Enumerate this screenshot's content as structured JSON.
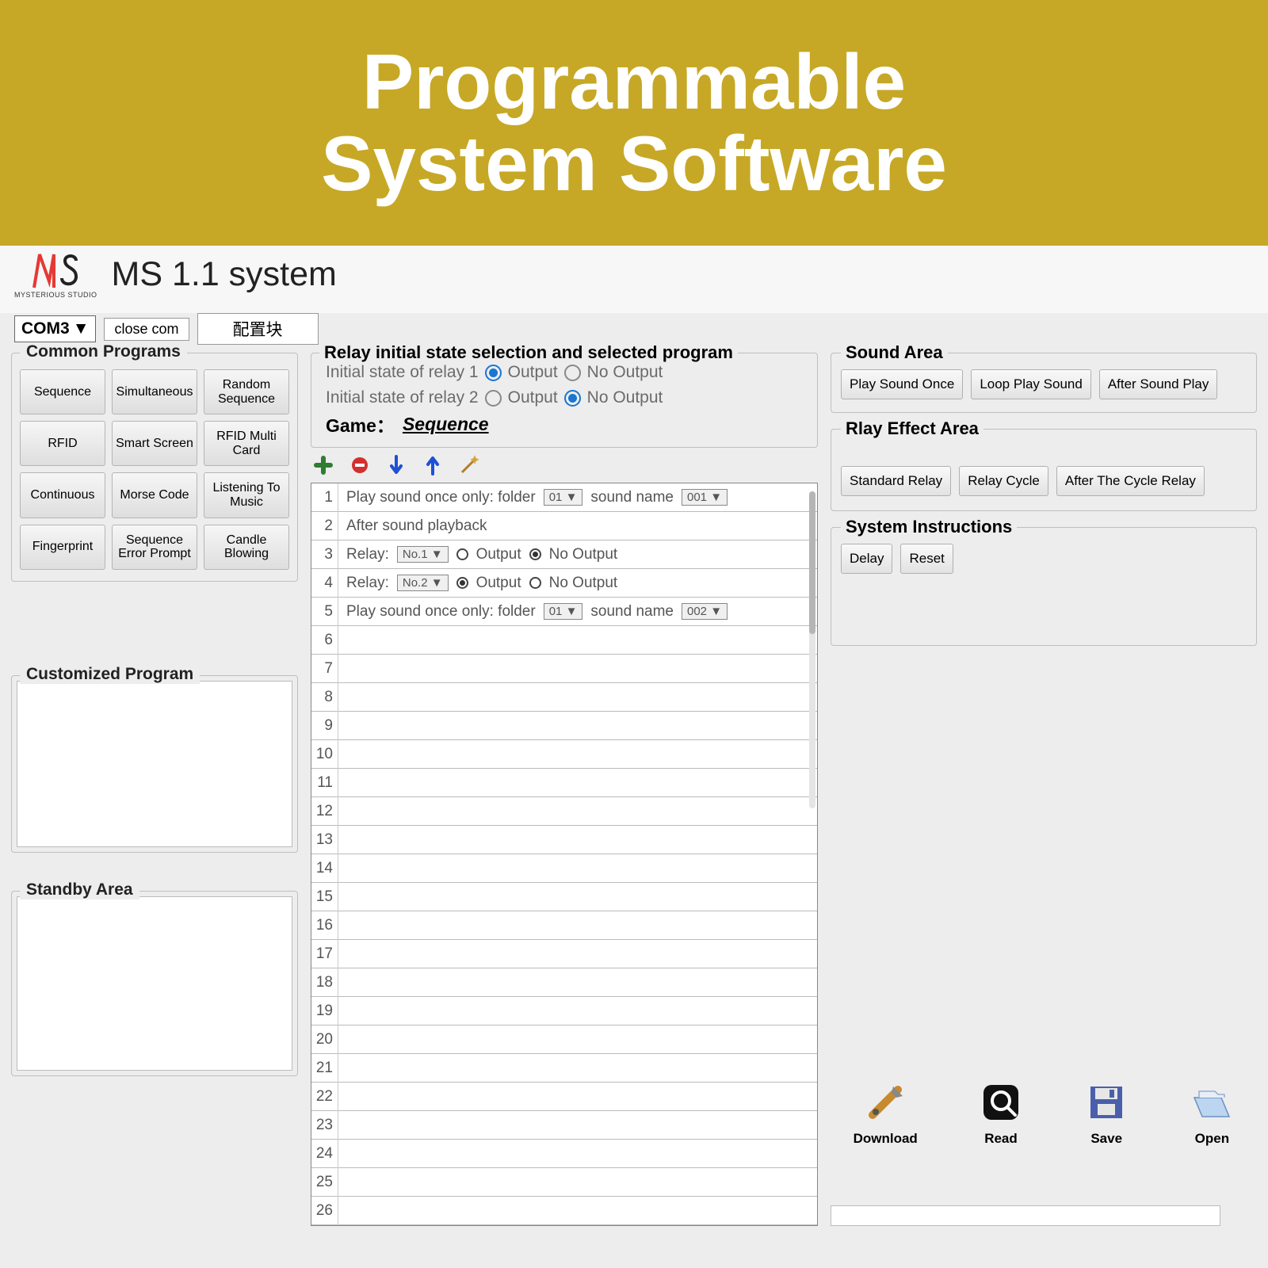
{
  "banner": {
    "line1": "Programmable",
    "line2": "System Software"
  },
  "app": {
    "title": "MS 1.1 system",
    "logo_sub": "MYSTERIOUS STUDIO"
  },
  "topbar": {
    "com": "COM3",
    "close": "close  com",
    "config": "配置块"
  },
  "common": {
    "title": "Common Programs",
    "items": [
      "Sequence",
      "Simultaneous",
      "Random Sequence",
      "RFID",
      "Smart Screen",
      "RFID Multi Card",
      "Continuous",
      "Morse Code",
      "Listening To Music",
      "Fingerprint",
      "Sequence Error Prompt",
      "Candle Blowing"
    ]
  },
  "custom": {
    "title": "Customized Program"
  },
  "standby": {
    "title": "Standby Area"
  },
  "relay": {
    "title": "Relay initial state selection and selected program",
    "row1_label": "Initial state of relay 1",
    "row2_label": "Initial state of relay 2",
    "output": "Output",
    "no_output": "No Output",
    "row1_selected": "output",
    "row2_selected": "no_output",
    "game_label": "Game：",
    "game_value": "Sequence"
  },
  "editor": {
    "row_count": 26,
    "entries": {
      "1": {
        "prefix": "Play sound once only: folder",
        "folder": "01",
        "mid": "sound name",
        "sound": "001"
      },
      "2": {
        "text": "After sound playback"
      },
      "3": {
        "label": "Relay:",
        "no": "No.1",
        "selected": "no_output",
        "o": "Output",
        "n": "No Output"
      },
      "4": {
        "label": "Relay:",
        "no": "No.2",
        "selected": "output",
        "o": "Output",
        "n": "No Output"
      },
      "5": {
        "prefix": "Play sound once only: folder",
        "folder": "01",
        "mid": "sound name",
        "sound": "002"
      }
    }
  },
  "sound_area": {
    "title": "Sound Area",
    "buttons": [
      "Play Sound Once",
      "Loop Play Sound",
      "After Sound Play"
    ]
  },
  "relay_effect": {
    "title": "Rlay Effect Area",
    "buttons": [
      "Standard Relay",
      "Relay Cycle",
      "After The Cycle Relay"
    ]
  },
  "sys_instr": {
    "title": "System Instructions",
    "buttons": [
      "Delay",
      "Reset"
    ]
  },
  "actions": {
    "download": "Download",
    "read": "Read",
    "save": "Save",
    "open": "Open"
  },
  "progress": {
    "pct": "0%"
  }
}
